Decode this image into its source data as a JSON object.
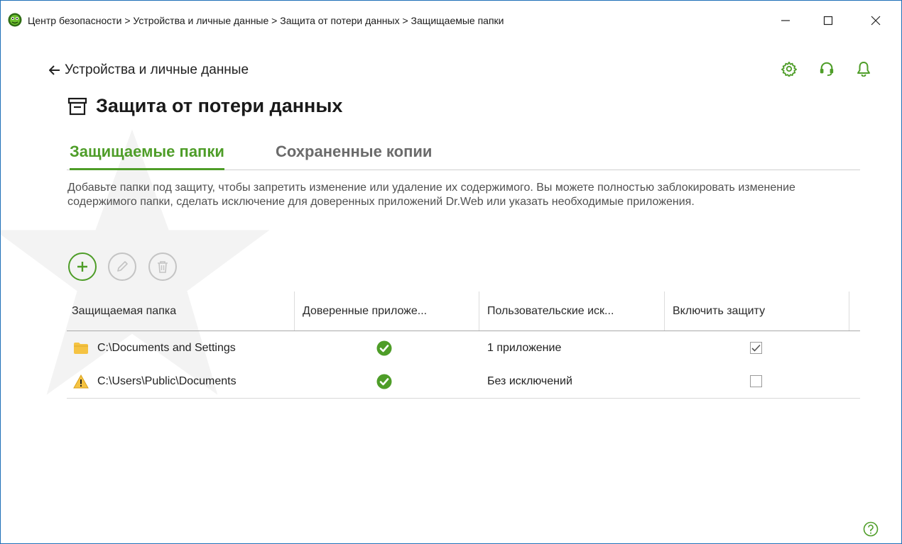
{
  "window": {
    "title": "Центр безопасности > Устройства и личные данные > Защита от потери данных > Защищаемые папки",
    "controls": {
      "minimize": "—",
      "maximize": "☐",
      "close": "✕"
    }
  },
  "header": {
    "back_label": "Устройства и личные данные",
    "icons": [
      "gear-icon",
      "headset-icon",
      "bell-icon"
    ],
    "accent_color": "#4e9d28"
  },
  "page": {
    "title": "Защита от потери данных"
  },
  "tabs": [
    {
      "label": "Защищаемые папки",
      "active": true
    },
    {
      "label": "Сохраненные копии",
      "active": false
    }
  ],
  "description": "Добавьте папки под защиту, чтобы запретить изменение или удаление их содержимого. Вы можете полностью заблокировать изменение содержимого папки, сделать исключение для доверенных приложений Dr.Web или указать необходимые приложения.",
  "toolbar": [
    {
      "name": "add-icon",
      "enabled": true
    },
    {
      "name": "edit-icon",
      "enabled": false
    },
    {
      "name": "delete-icon",
      "enabled": false
    }
  ],
  "table": {
    "columns": [
      "Защищаемая папка",
      "Доверенные приложе...",
      "Пользовательские иск...",
      "Включить защиту"
    ],
    "rows": [
      {
        "icon": "folder-icon",
        "folder": "C:\\Documents and Settings",
        "trusted": "check-circle-icon",
        "exceptions": "1 приложение",
        "enabled": true
      },
      {
        "icon": "warning-icon",
        "folder": "C:\\Users\\Public\\Documents",
        "trusted": "check-circle-icon",
        "exceptions": "Без исключений",
        "enabled": false
      }
    ]
  }
}
